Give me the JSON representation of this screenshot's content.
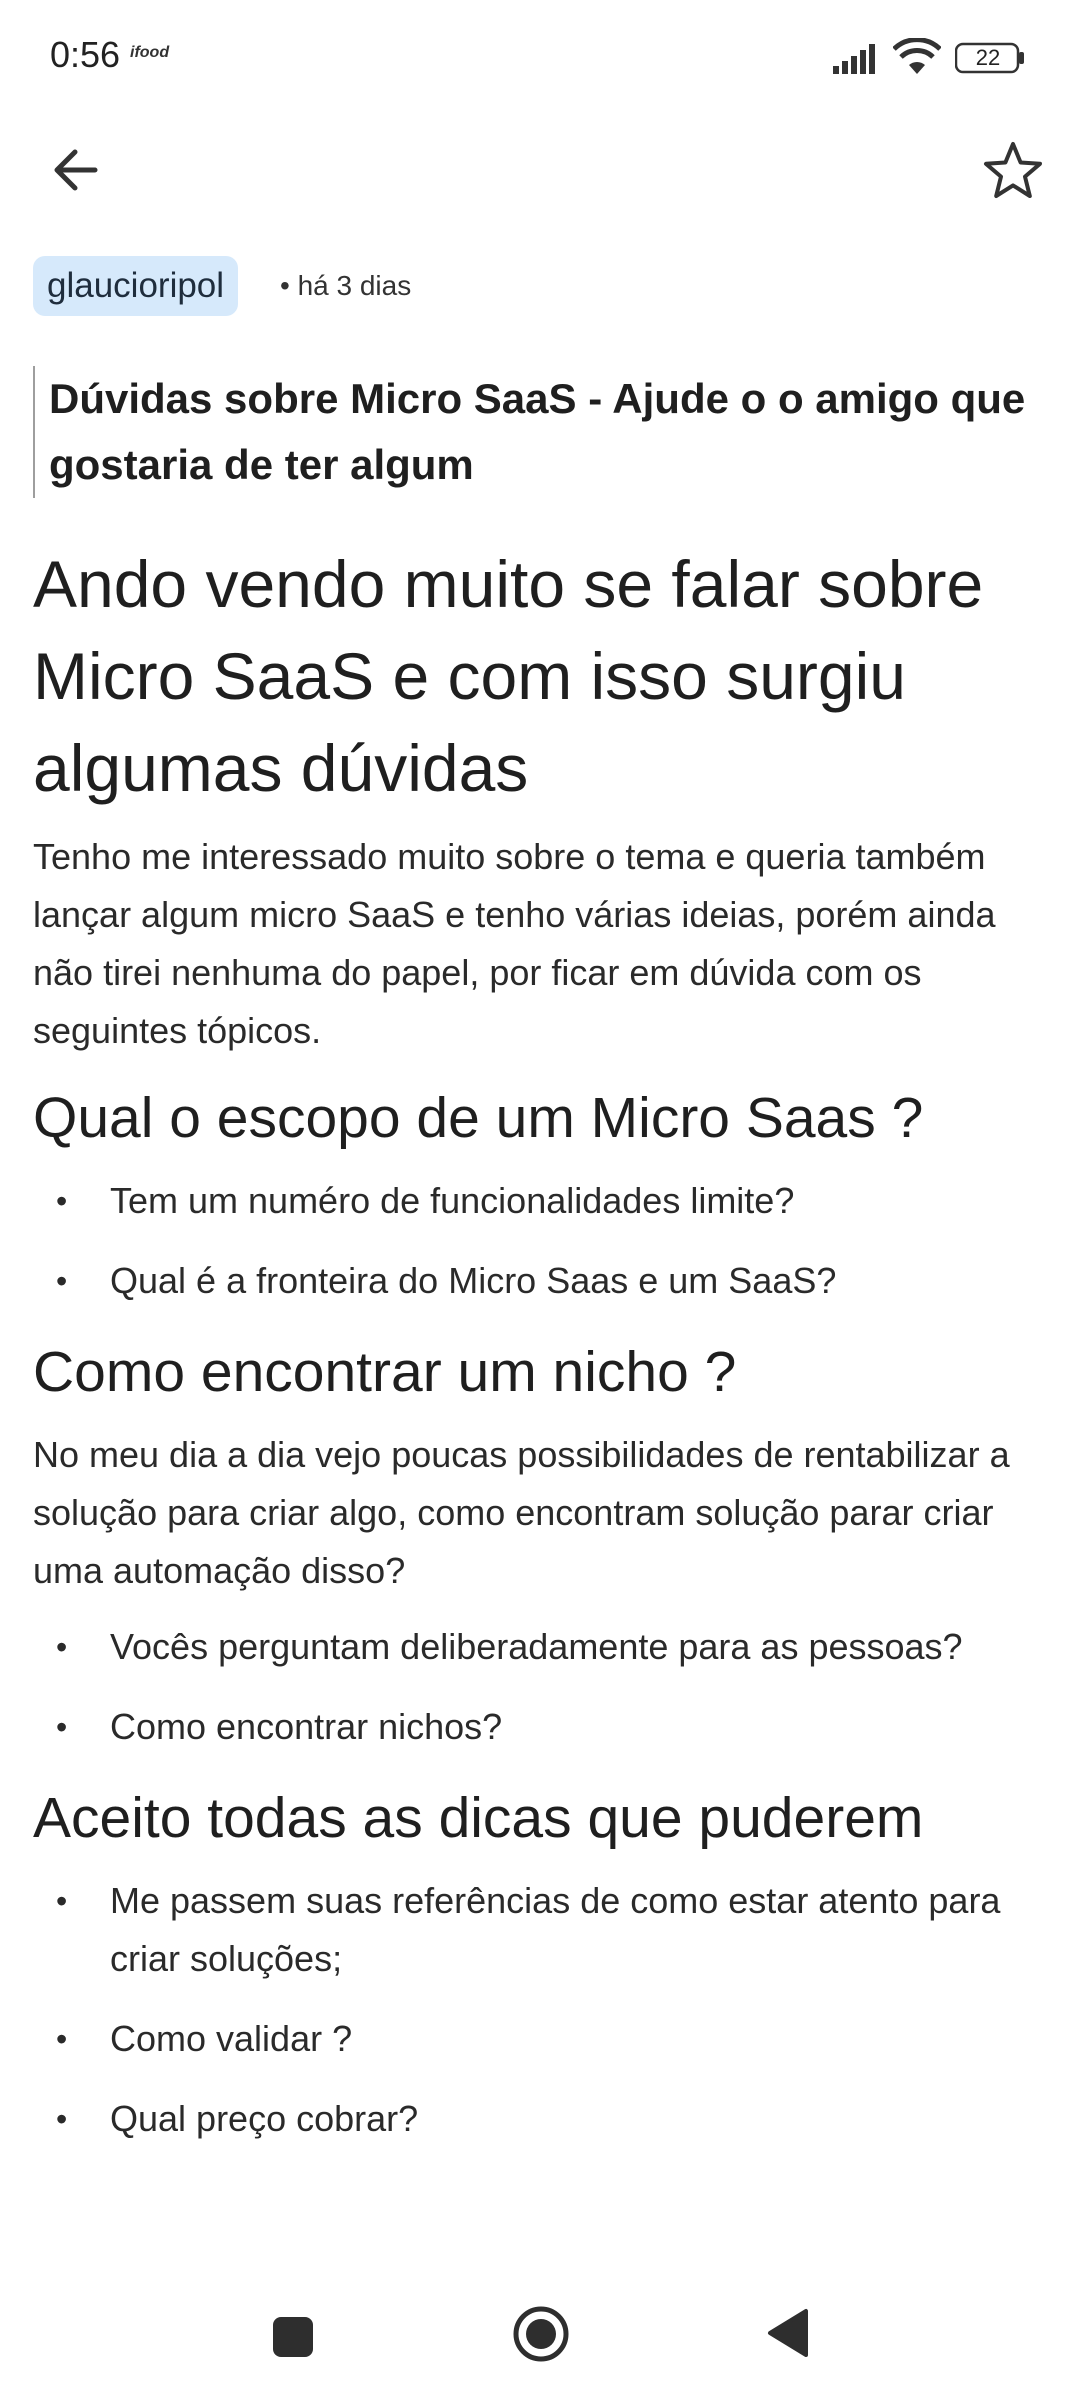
{
  "status_bar": {
    "time": "0:56",
    "app_icon_text": "ifood",
    "battery": "22"
  },
  "app_bar": {
    "back_icon": "arrow-left-icon",
    "favorite_icon": "star-outline-icon"
  },
  "post": {
    "author": "glaucioripol",
    "meta": "• há 3 dias",
    "title": "Dúvidas sobre Micro SaaS - Ajude o o amigo que gostaria de ter algum",
    "heading": "Ando vendo muito se falar sobre Micro SaaS e com isso surgiu algumas dúvidas",
    "intro": "Tenho me interessado muito sobre o tema e queria também lançar algum micro SaaS e tenho várias ideias, porém ainda não tirei nenhuma do papel, por ficar em dúvida com os seguintes tópicos.",
    "section1": {
      "title": "Qual o escopo de um Micro Saas ?",
      "items": [
        "Tem um numéro de funcionalidades limite?",
        "Qual é a fronteira do Micro Saas e um SaaS?"
      ]
    },
    "section2": {
      "title": "Como encontrar um nicho ?",
      "text": "No meu dia a dia vejo poucas possibilidades de rentabilizar a solução para criar algo, como encontram solução parar criar uma automação disso?",
      "items": [
        "Vocês perguntam deliberadamente para as pessoas?",
        "Como encontrar nichos?"
      ]
    },
    "section3": {
      "title": "Aceito todas as dicas que puderem",
      "items": [
        "Me passem suas referências de como estar atento para criar soluções;",
        "Como validar ?",
        "Qual preço cobrar?"
      ]
    }
  },
  "nav_bar": {
    "recents_icon": "square-icon",
    "home_icon": "circle-home-icon",
    "back_icon": "triangle-back-icon"
  }
}
